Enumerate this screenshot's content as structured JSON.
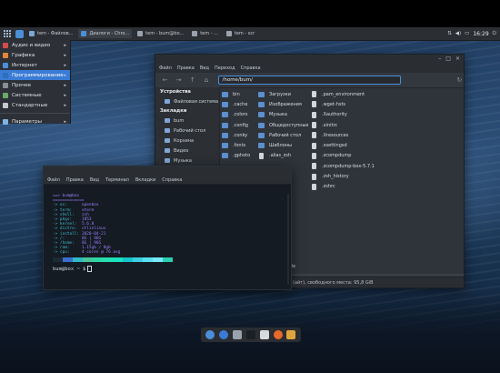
{
  "panel": {
    "tasks": [
      {
        "label": "tem - Файлов...",
        "active": false
      },
      {
        "label": "Диалоги - Chro...",
        "active": true
      },
      {
        "label": "tem - bum@bo...",
        "active": false
      },
      {
        "label": "tem - ...",
        "active": false
      },
      {
        "label": "tem - scr",
        "active": false
      }
    ],
    "tray_icons": [
      "network-icon",
      "volume-icon",
      "battery-icon",
      "power-icon"
    ],
    "clock": "16:29"
  },
  "start_menu": {
    "items": [
      {
        "label": "Аудио и видео",
        "icon_color": "#d44b4b"
      },
      {
        "label": "Графика",
        "icon_color": "#e3863a"
      },
      {
        "label": "Интернет",
        "icon_color": "#4a8fd8"
      },
      {
        "label": "Программирование",
        "icon_color": "#2d6fbf",
        "highlighted": true
      },
      {
        "label": "Прочее",
        "icon_color": "#8a8f96"
      },
      {
        "label": "Системные",
        "icon_color": "#6aa86a"
      },
      {
        "label": "Стандартные",
        "icon_color": "#c9c9c9"
      }
    ],
    "footer": {
      "label": "Параметры",
      "icon_color": "#7fb3e3"
    }
  },
  "file_manager": {
    "menu": [
      "Файл",
      "Правка",
      "Вид",
      "Переход",
      "Справка"
    ],
    "path": "/home/bum/",
    "sidebar": {
      "devices_heading": "Устройства",
      "devices": [
        "Файловая система"
      ],
      "bookmarks_heading": "Закладки",
      "bookmarks": [
        "bum",
        "Рабочий стол",
        "Корзина",
        "Видео",
        "Музыка"
      ]
    },
    "columns": [
      [
        "bin",
        ".cache",
        ".colors",
        ".config",
        ".conky",
        ".fonts",
        ".gphoto"
      ],
      [
        "Загрузки",
        "Изображения",
        "Музыка",
        "Общедоступные",
        "Рабочий стол",
        "Шаблоны",
        ".alias_zsh"
      ],
      [
        ".pam_environment",
        ".wget-hsts",
        ".Xauthority",
        ".xinitrc",
        ".Xresources",
        ".xsettingsd",
        ".zcompdump",
        ".zcompdump-box-5.7.1",
        ".zsh_history",
        ".zshrc"
      ]
    ],
    "doc_files": [
      ".alias_zsh",
      ".pam_environment",
      ".wget-hsts",
      ".Xauthority",
      ".xinitrc",
      ".Xresources",
      ".xsettingsd",
      ".zcompdump",
      ".zcompdump-box-5.7.1",
      ".zsh_history",
      ".zshrc"
    ],
    "partial_file": "ckle",
    "status": "(айт), свободного места: 95,8 GiB"
  },
  "terminal": {
    "menu": [
      "Файл",
      "Правка",
      "Вид",
      "Терминал",
      "Вкладки",
      "Справка"
    ],
    "header": "==> bum@box",
    "rule": "=============",
    "fields": [
      {
        "key": "-> os:",
        "value": "openbox"
      },
      {
        "key": "-> term:",
        "value": "xterm"
      },
      {
        "key": "-> shell:",
        "value": "zsh"
      },
      {
        "key": "-> pkgs:",
        "value": "1853"
      },
      {
        "key": "-> kernel:",
        "value": "5.6.0"
      },
      {
        "key": "-> distro:",
        "value": "ctlinlinux"
      },
      {
        "key": "-> install:",
        "value": "2020-04-21"
      },
      {
        "key": "-> /:",
        "value": "8G | 96G"
      },
      {
        "key": "-> /home:",
        "value": "8G | 96G"
      },
      {
        "key": "-> ram:",
        "value": "1.15gb / 8gb"
      },
      {
        "key": "-> cpu:",
        "value": "4 cores @ 76 avg"
      }
    ],
    "palette": [
      "#1d2a36",
      "#3a6fd0",
      "#2fb8c6",
      "#46c69a",
      "#2fd6a6",
      "#25e0b0",
      "#18e2c0",
      "#14c4c9",
      "#3ad0e0",
      "#56e0f0",
      "#78e8ff",
      "#2ad1ae"
    ],
    "prompt": "bum@box ~ $"
  },
  "dock": {
    "icons": [
      {
        "name": "browser-icon",
        "color": "#4a8fd8",
        "round": true
      },
      {
        "name": "qbittorrent-icon",
        "color": "#3a7bd5",
        "round": true
      },
      {
        "name": "archive-icon",
        "color": "#9aa3ad",
        "round": false
      },
      {
        "name": "terminal-icon",
        "color": "#1b1e22",
        "round": false
      },
      {
        "name": "text-editor-icon",
        "color": "#d7dbe0",
        "round": false
      },
      {
        "name": "firefox-icon",
        "color": "#e8692b",
        "round": true
      },
      {
        "name": "download-icon",
        "color": "#e0a43c",
        "round": false
      }
    ]
  }
}
